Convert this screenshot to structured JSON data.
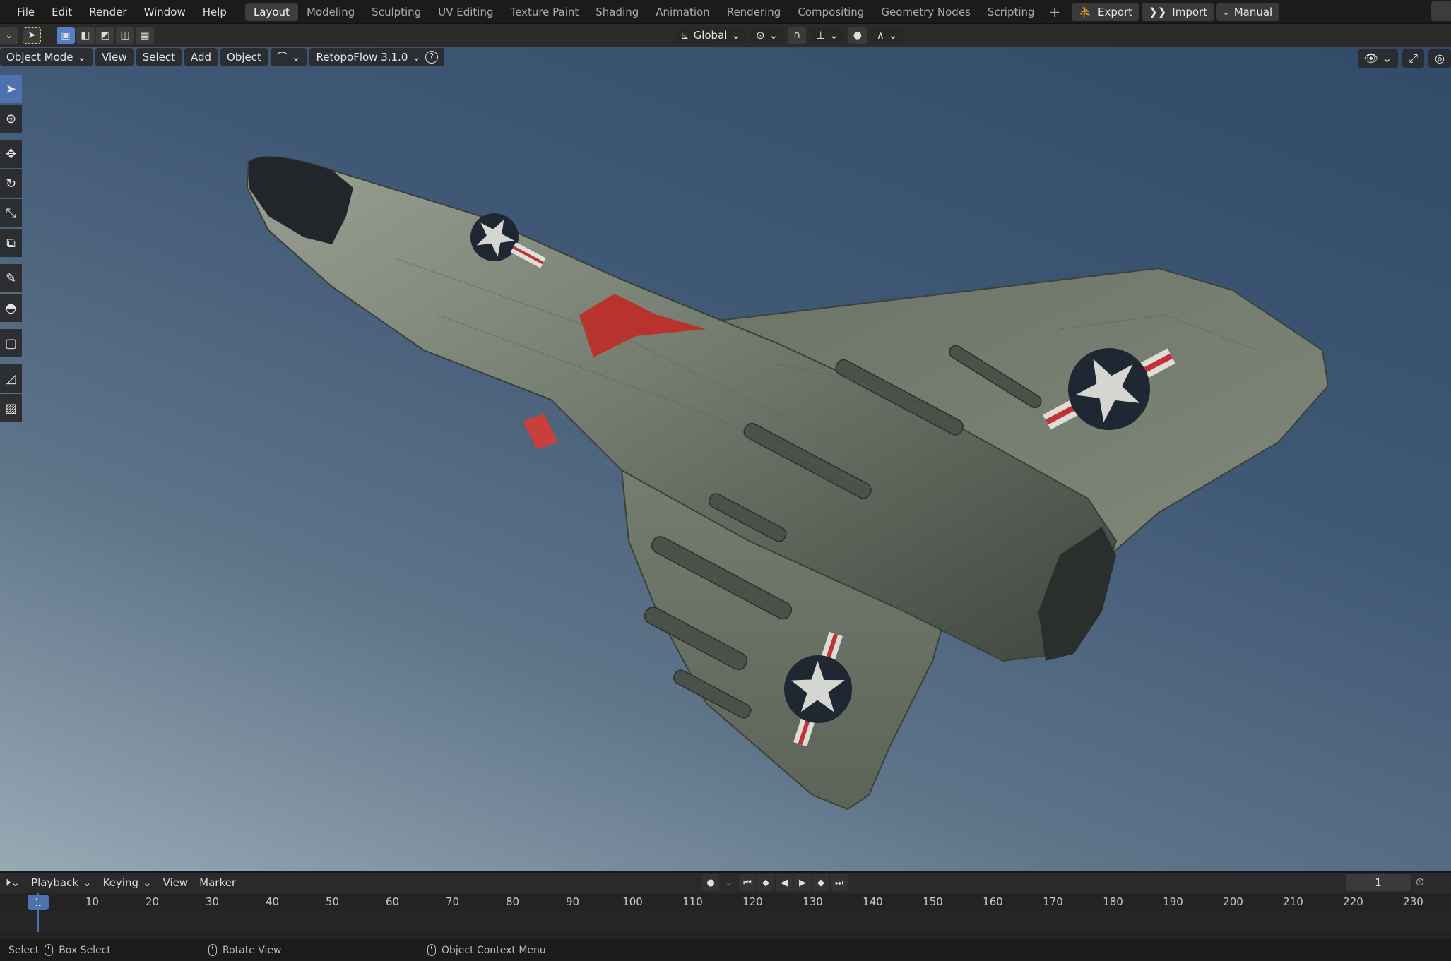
{
  "menu": [
    "File",
    "Edit",
    "Render",
    "Window",
    "Help"
  ],
  "workspaces": [
    {
      "label": "Layout",
      "active": true
    },
    {
      "label": "Modeling",
      "active": false
    },
    {
      "label": "Sculpting",
      "active": false
    },
    {
      "label": "UV Editing",
      "active": false
    },
    {
      "label": "Texture Paint",
      "active": false
    },
    {
      "label": "Shading",
      "active": false
    },
    {
      "label": "Animation",
      "active": false
    },
    {
      "label": "Rendering",
      "active": false
    },
    {
      "label": "Compositing",
      "active": false
    },
    {
      "label": "Geometry Nodes",
      "active": false
    },
    {
      "label": "Scripting",
      "active": false
    }
  ],
  "addon_buttons": {
    "export": "Export",
    "import": "Import",
    "manual": "Manual"
  },
  "tool_header": {
    "orientation": "Global"
  },
  "viewport_header": {
    "mode": "Object Mode",
    "view": "View",
    "select": "Select",
    "add": "Add",
    "object": "Object",
    "retopoflow": "RetopoFlow 3.1.0",
    "help": "?"
  },
  "timeline": {
    "playback": "Playback",
    "keying": "Keying",
    "view": "View",
    "marker": "Marker",
    "current_frame": "1",
    "frame_field": "1",
    "ticks": [
      "10",
      "20",
      "30",
      "40",
      "50",
      "60",
      "70",
      "80",
      "90",
      "100",
      "110",
      "120",
      "130",
      "140",
      "150",
      "160",
      "170",
      "180",
      "190",
      "200",
      "210",
      "220",
      "230"
    ]
  },
  "statusbar": {
    "select": "Select",
    "box_select": "Box Select",
    "rotate_view": "Rotate View",
    "context_menu": "Object Context Menu"
  },
  "colors": {
    "accent": "#4c72b0",
    "insignia_red": "#c0313a",
    "aircraft": "#7d8677"
  }
}
